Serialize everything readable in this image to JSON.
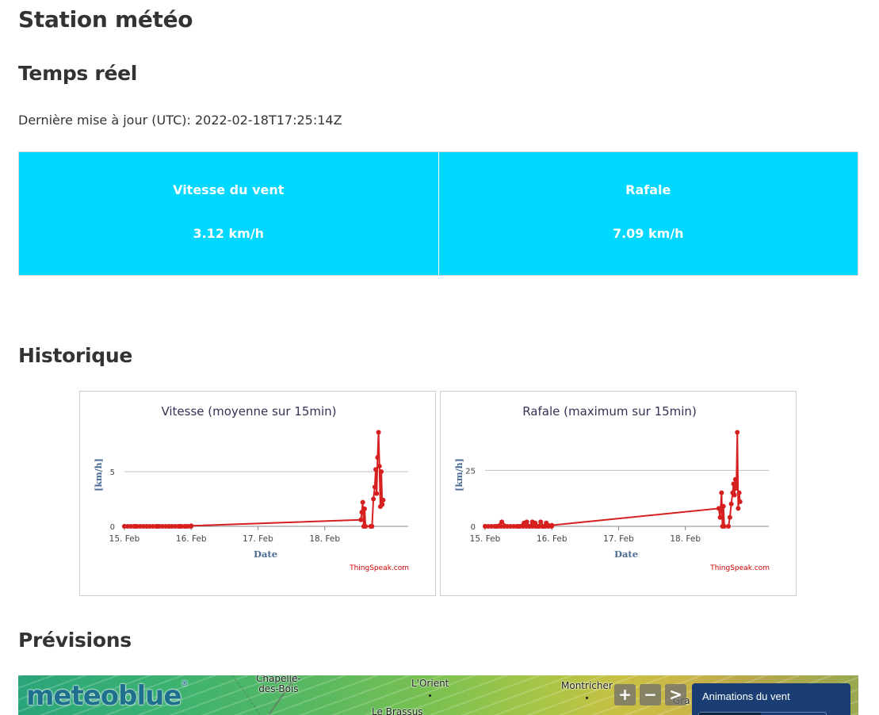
{
  "page": {
    "title": "Station météo",
    "realtime_heading": "Temps réel",
    "updated_label": "Dernière mise à jour (UTC): 2022-02-18T17:25:14Z",
    "history_heading": "Historique",
    "forecast_heading": "Prévisions"
  },
  "realtime": {
    "wind": {
      "label": "Vitesse du vent",
      "value": "3.12 km/h"
    },
    "gust": {
      "label": "Rafale",
      "value": "7.09 km/h"
    },
    "color": "#00d8ff"
  },
  "chart_data": [
    {
      "type": "line",
      "title": "Vitesse (moyenne sur 15min)",
      "xlabel": "Date",
      "ylabel": "[km/h]",
      "credit": "ThingSpeak.com",
      "xlim": [
        "2022-02-15T00:00",
        "2022-02-19T06:00"
      ],
      "ylim": [
        0,
        8.7
      ],
      "x_ticks": [
        "15. Feb",
        "16. Feb",
        "17. Feb",
        "18. Feb"
      ],
      "y_ticks": [
        "0",
        "5"
      ],
      "series_color": "#d62020",
      "points": [
        [
          "2022-02-15T00:00",
          0
        ],
        [
          "2022-02-15T04:00",
          0
        ],
        [
          "2022-02-15T08:00",
          0
        ],
        [
          "2022-02-15T12:00",
          0
        ],
        [
          "2022-02-15T16:00",
          0
        ],
        [
          "2022-02-15T20:00",
          0
        ],
        [
          "2022-02-15T22:00",
          0
        ],
        [
          "2022-02-16T00:00",
          0.05
        ],
        [
          "2022-02-18T13:00",
          0.6
        ],
        [
          "2022-02-18T13:20",
          1.3
        ],
        [
          "2022-02-18T13:40",
          2.2
        ],
        [
          "2022-02-18T14:00",
          0
        ],
        [
          "2022-02-18T14:20",
          1.6
        ],
        [
          "2022-02-18T14:40",
          0
        ],
        [
          "2022-02-18T16:30",
          0
        ],
        [
          "2022-02-18T17:00",
          0
        ],
        [
          "2022-02-18T17:30",
          2.5
        ],
        [
          "2022-02-18T18:00",
          3.6
        ],
        [
          "2022-02-18T18:20",
          5.2
        ],
        [
          "2022-02-18T18:40",
          3.0
        ],
        [
          "2022-02-18T19:00",
          6.3
        ],
        [
          "2022-02-18T19:20",
          8.6
        ],
        [
          "2022-02-18T19:40",
          5.5
        ],
        [
          "2022-02-18T20:00",
          1.8
        ],
        [
          "2022-02-18T20:20",
          5.0
        ],
        [
          "2022-02-18T20:40",
          2.0
        ],
        [
          "2022-02-18T21:00",
          2.4
        ]
      ]
    },
    {
      "type": "line",
      "title": "Rafale (maximum sur 15min)",
      "xlabel": "Date",
      "ylabel": "[km/h]",
      "credit": "ThingSpeak.com",
      "xlim": [
        "2022-02-15T00:00",
        "2022-02-19T06:00"
      ],
      "ylim": [
        0,
        42.5
      ],
      "x_ticks": [
        "15. Feb",
        "16. Feb",
        "17. Feb",
        "18. Feb"
      ],
      "y_ticks": [
        "0",
        "25"
      ],
      "series_color": "#d62020",
      "points": [
        [
          "2022-02-15T00:00",
          0
        ],
        [
          "2022-02-15T04:00",
          0
        ],
        [
          "2022-02-15T06:00",
          2
        ],
        [
          "2022-02-15T08:00",
          0
        ],
        [
          "2022-02-15T12:00",
          0
        ],
        [
          "2022-02-15T14:00",
          1.5
        ],
        [
          "2022-02-15T15:00",
          2
        ],
        [
          "2022-02-15T16:00",
          0
        ],
        [
          "2022-02-15T17:00",
          2
        ],
        [
          "2022-02-15T18:00",
          1.5
        ],
        [
          "2022-02-15T19:00",
          0
        ],
        [
          "2022-02-15T20:00",
          2
        ],
        [
          "2022-02-15T21:00",
          0
        ],
        [
          "2022-02-15T22:00",
          1.5
        ],
        [
          "2022-02-16T00:00",
          0.5
        ],
        [
          "2022-02-18T12:00",
          8
        ],
        [
          "2022-02-18T12:30",
          4
        ],
        [
          "2022-02-18T13:00",
          15
        ],
        [
          "2022-02-18T13:20",
          0
        ],
        [
          "2022-02-18T13:40",
          9
        ],
        [
          "2022-02-18T14:00",
          0
        ],
        [
          "2022-02-18T15:30",
          0
        ],
        [
          "2022-02-18T16:00",
          4
        ],
        [
          "2022-02-18T16:30",
          10
        ],
        [
          "2022-02-18T17:00",
          15
        ],
        [
          "2022-02-18T17:20",
          19
        ],
        [
          "2022-02-18T17:40",
          14
        ],
        [
          "2022-02-18T18:00",
          21
        ],
        [
          "2022-02-18T18:20",
          17
        ],
        [
          "2022-02-18T18:40",
          42
        ],
        [
          "2022-02-18T19:00",
          8
        ],
        [
          "2022-02-18T19:20",
          15
        ],
        [
          "2022-02-18T19:40",
          11
        ]
      ]
    }
  ],
  "map": {
    "logo": "meteoblue",
    "logo_mark": "®",
    "places": [
      {
        "name_line1": "Chapelle-",
        "name_line2": "des-Bois"
      },
      {
        "name_line1": "L'Orient",
        "name_line2": ""
      },
      {
        "name_line1": "Le Brassus",
        "name_line2": ""
      },
      {
        "name_line1": "Montricher",
        "name_line2": ""
      },
      {
        "name_line1": "Gra",
        "name_line2": ""
      }
    ],
    "zoom_in": "+",
    "zoom_out": "−",
    "next": ">",
    "animation_title": "Animations du vent"
  }
}
